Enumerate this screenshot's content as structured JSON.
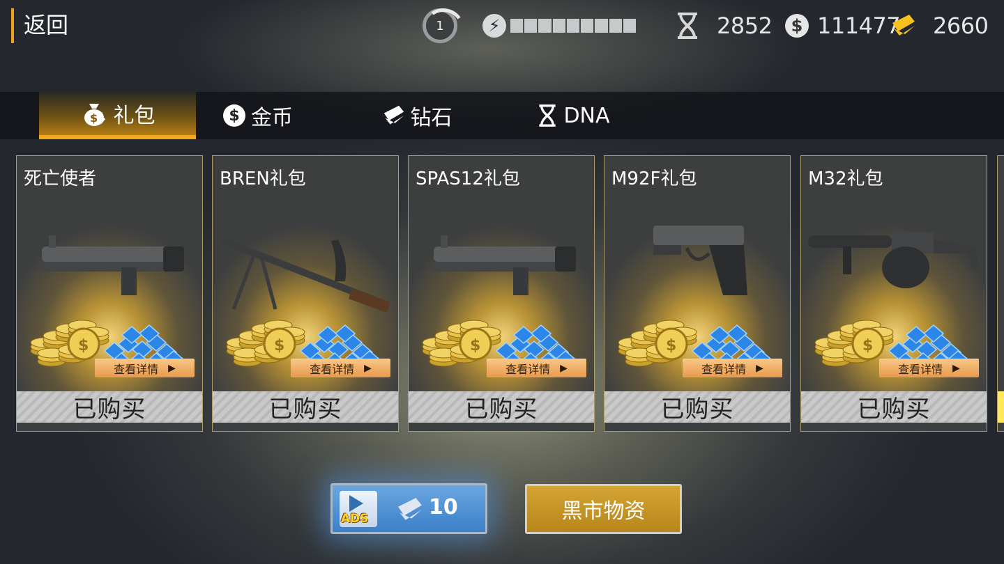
{
  "header": {
    "back_label": "返回",
    "level": "1",
    "energy_segments": 9,
    "dna_value": "2852",
    "coin_value": "111477",
    "diamond_value": "2660"
  },
  "tabs": [
    {
      "label": "礼包",
      "icon": "gift-bag-icon",
      "active": true
    },
    {
      "label": "金币",
      "icon": "coin-icon",
      "active": false
    },
    {
      "label": "钻石",
      "icon": "diamond-icon",
      "active": false
    },
    {
      "label": "DNA",
      "icon": "dna-icon",
      "active": false
    }
  ],
  "cards": [
    {
      "title": "死亡使者",
      "details_label": "查看详情",
      "status_label": "已购买",
      "weapon": "shotgun"
    },
    {
      "title": "BREN礼包",
      "details_label": "查看详情",
      "status_label": "已购买",
      "weapon": "machine-gun"
    },
    {
      "title": "SPAS12礼包",
      "details_label": "查看详情",
      "status_label": "已购买",
      "weapon": "shotgun"
    },
    {
      "title": "M92F礼包",
      "details_label": "查看详情",
      "status_label": "已购买",
      "weapon": "pistol"
    },
    {
      "title": "M32礼包",
      "details_label": "查看详情",
      "status_label": "已购买",
      "weapon": "grenade-launcher"
    }
  ],
  "ads_button": {
    "label": "ADS",
    "reward": "10"
  },
  "market_button": {
    "label": "黑市物资"
  },
  "colors": {
    "accent": "#f2a81d",
    "ads_blue": "#3b80c9",
    "market_gold": "#c4941f"
  }
}
